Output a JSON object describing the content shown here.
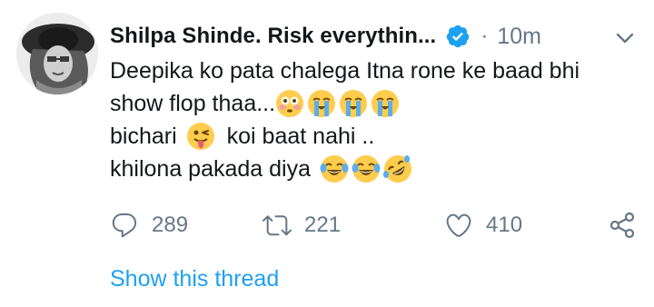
{
  "tweet": {
    "author_name": "Shilpa Shinde. Risk everythin...",
    "separator": "·",
    "timestamp": "10m",
    "lines": [
      {
        "text": "Deepika ko pata chalega Itna rone ke baad bhi"
      },
      {
        "text": "show flop thaa...",
        "emojis": [
          "flushed-face-emoji",
          "loudly-crying-face-emoji",
          "loudly-crying-face-emoji",
          "loudly-crying-face-emoji"
        ]
      },
      {
        "text": "bichari",
        "emoji_after": "winking-face-tongue-emoji",
        "text_after": "koi baat nahi .."
      },
      {
        "text": "khilona pakada diya",
        "emojis": [
          "face-with-tears-of-joy-emoji",
          "face-with-tears-of-joy-emoji",
          "rolling-on-floor-laughing-emoji"
        ]
      }
    ],
    "actions": {
      "reply_count": "289",
      "retweet_count": "221",
      "like_count": "410"
    },
    "show_thread_label": "Show this thread",
    "colors": {
      "text": "#14171a",
      "secondary": "#657786",
      "link": "#1da1f2",
      "verified": "#1da1f2"
    }
  }
}
